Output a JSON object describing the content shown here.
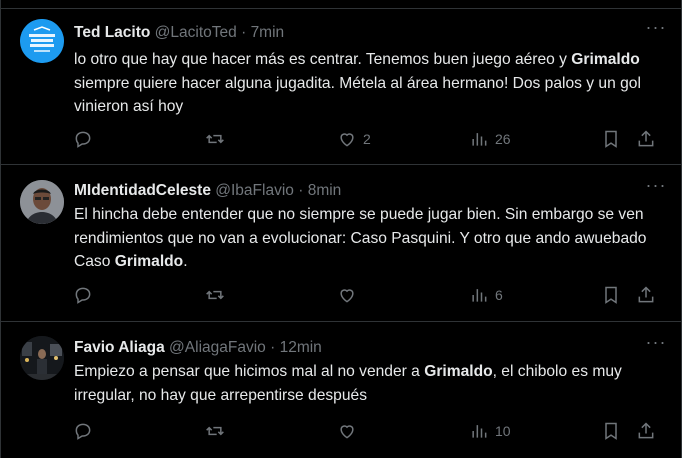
{
  "tweets": [
    {
      "name": "Ted Lacito",
      "handle": "@LacitoTed",
      "sep": "·",
      "time": "7min",
      "avatar": "club-crest-avatar",
      "text": [
        {
          "t": "lo otro que hay que hacer más es centrar. Tenemos buen juego aéreo y "
        },
        {
          "t": "Grimaldo",
          "b": true
        },
        {
          "t": " siempre quiere hacer alguna jugadita. Métela al área hermano! Dos palos y un gol vinieron así hoy"
        }
      ],
      "stats": {
        "replies": "",
        "reposts": "",
        "likes": "2",
        "views": "26"
      }
    },
    {
      "name": "MIdentidadCeleste",
      "handle": "@IbaFlavio",
      "sep": "·",
      "time": "8min",
      "avatar": "person-photo-avatar",
      "text": [
        {
          "t": "El hincha debe entender que no siempre se puede jugar bien. Sin embargo se ven rendimientos que no van a evolucionar: Caso Pasquini. Y otro que ando awuebado Caso "
        },
        {
          "t": "Grimaldo",
          "b": true
        },
        {
          "t": "."
        }
      ],
      "stats": {
        "replies": "",
        "reposts": "",
        "likes": "",
        "views": "6"
      }
    },
    {
      "name": "Favio Aliaga",
      "handle": "@AliagaFavio",
      "sep": "·",
      "time": "12min",
      "avatar": "night-street-photo-avatar",
      "text": [
        {
          "t": "Empiezo a pensar que hicimos mal al no vender a "
        },
        {
          "t": "Grimaldo",
          "b": true
        },
        {
          "t": ", el chibolo es muy irregular, no hay que arrepentirse después"
        }
      ],
      "stats": {
        "replies": "",
        "reposts": "",
        "likes": "",
        "views": "10"
      }
    }
  ],
  "icons": {
    "reply": "reply-icon",
    "repost": "repost-icon",
    "like": "heart-icon",
    "views": "views-chart-icon",
    "bookmark": "bookmark-icon",
    "share": "share-icon",
    "more": "more-dots-icon"
  },
  "colors": {
    "background": "#000000",
    "text": "#e7e9ea",
    "muted": "#71767b",
    "divider": "#2f3336",
    "crest": "#1d9bf0"
  }
}
